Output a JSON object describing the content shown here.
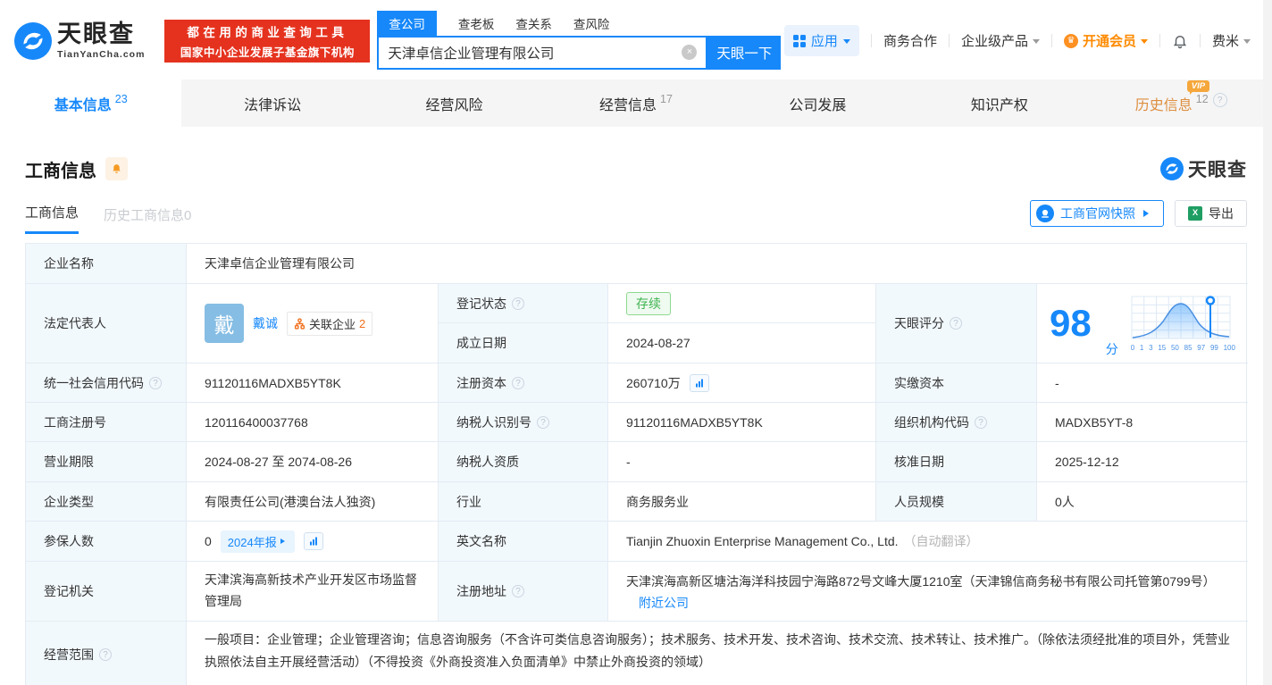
{
  "icons": {
    "question": "?",
    "clear": "×",
    "excel": "X",
    "crown": "♛"
  },
  "header": {
    "logo": {
      "title": "天眼查",
      "subtitle": "TianYanCha.com"
    },
    "slogan": {
      "line1": "都在用的商业查询工具",
      "line2": "国家中小企业发展子基金旗下机构"
    },
    "search": {
      "tabs": [
        {
          "label": "查公司"
        },
        {
          "label": "查老板"
        },
        {
          "label": "查关系"
        },
        {
          "label": "查风险"
        }
      ],
      "value": "天津卓信企业管理有限公司",
      "button": "天眼一下"
    },
    "menu": {
      "apps": "应用",
      "cooperation": "商务合作",
      "enterprise": "企业级产品",
      "vip": "开通会员",
      "user": "费米"
    }
  },
  "nav": {
    "tabs": [
      {
        "label": "基本信息",
        "count": "23"
      },
      {
        "label": "法律诉讼",
        "count": ""
      },
      {
        "label": "经营风险",
        "count": ""
      },
      {
        "label": "经营信息",
        "count": "17"
      },
      {
        "label": "公司发展",
        "count": ""
      },
      {
        "label": "知识产权",
        "count": ""
      },
      {
        "label": "历史信息",
        "count": "12",
        "vip": "VIP"
      }
    ]
  },
  "section": {
    "title": "工商信息",
    "brand": "天眼查",
    "subtabs": [
      {
        "label": "工商信息"
      },
      {
        "label": "历史工商信息0"
      }
    ],
    "snapshot_button": "工商官网快照",
    "export_button": "导出"
  },
  "info": {
    "company_name": {
      "label": "企业名称",
      "value": "天津卓信企业管理有限公司"
    },
    "legal_rep": {
      "label": "法定代表人",
      "avatar": "戴",
      "name": "戴诚",
      "related_label": "关联企业",
      "related_count": "2"
    },
    "reg_status": {
      "label": "登记状态",
      "value": "存续"
    },
    "establish_date": {
      "label": "成立日期",
      "value": "2024-08-27"
    },
    "tyc_score": {
      "label": "天眼评分",
      "score": "98",
      "unit": "分",
      "axis": [
        "0",
        "1",
        "3",
        "15",
        "50",
        "85",
        "97",
        "99",
        "100"
      ]
    },
    "credit_code": {
      "label": "统一社会信用代码",
      "value": "91120116MADXB5YT8K"
    },
    "reg_capital": {
      "label": "注册资本",
      "value": "260710万"
    },
    "paid_capital": {
      "label": "实缴资本",
      "value": "-"
    },
    "reg_number": {
      "label": "工商注册号",
      "value": "120116400037768"
    },
    "taxpayer_id": {
      "label": "纳税人识别号",
      "value": "91120116MADXB5YT8K"
    },
    "org_code": {
      "label": "组织机构代码",
      "value": "MADXB5YT-8"
    },
    "business_term": {
      "label": "营业期限",
      "value": "2024-08-27 至 2074-08-26"
    },
    "taxpayer_quality": {
      "label": "纳税人资质",
      "value": "-"
    },
    "approval_date": {
      "label": "核准日期",
      "value": "2025-12-12"
    },
    "company_type": {
      "label": "企业类型",
      "value": "有限责任公司(港澳台法人独资)"
    },
    "industry": {
      "label": "行业",
      "value": "商务服务业"
    },
    "staff_size": {
      "label": "人员规模",
      "value": "0人"
    },
    "insured_count": {
      "label": "参保人数",
      "value": "0",
      "report_badge": "2024年报"
    },
    "english_name": {
      "label": "英文名称",
      "value": "Tianjin Zhuoxin Enterprise Management Co., Ltd.",
      "note": "（自动翻译）"
    },
    "reg_authority": {
      "label": "登记机关",
      "value": "天津滨海高新技术产业开发区市场监督管理局"
    },
    "reg_address": {
      "label": "注册地址",
      "value": "天津滨海高新区塘沽海洋科技园宁海路872号文峰大厦1210室（天津锦信商务秘书有限公司托管第0799号）",
      "nearby_link": "附近公司"
    },
    "business_scope": {
      "label": "经营范围",
      "value": "一般项目：企业管理；企业管理咨询；信息咨询服务（不含许可类信息咨询服务）；技术服务、技术开发、技术咨询、技术交流、技术转让、技术推广。（除依法须经批准的项目外，凭营业执照依法自主开展经营活动）（不得投资《外商投资准入负面清单》中禁止外商投资的领域）"
    }
  }
}
